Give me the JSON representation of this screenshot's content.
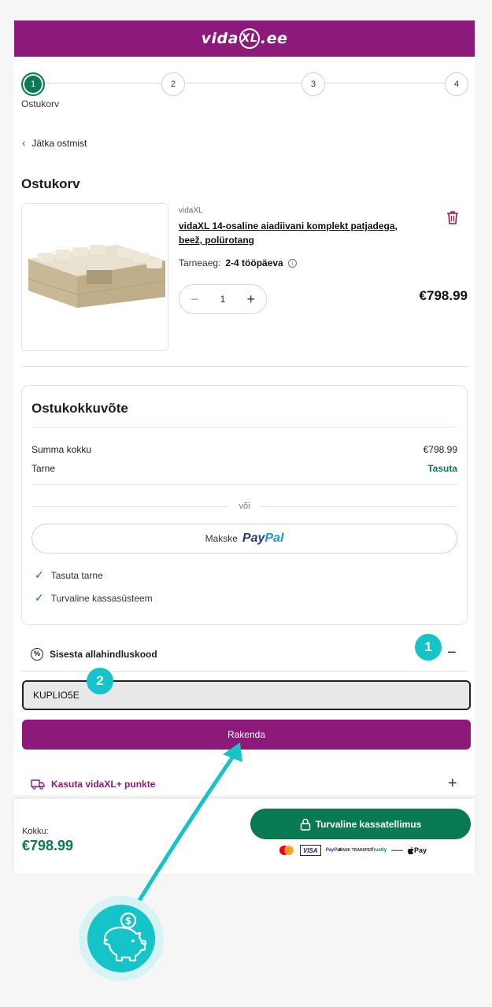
{
  "header": {
    "logo_part1": "vida",
    "logo_part2": "XL",
    "logo_part3": ".ee"
  },
  "stepper": {
    "steps": [
      "1",
      "2",
      "3",
      "4"
    ],
    "active_label": "Ostukorv"
  },
  "back_link": "Jätka ostmist",
  "cart": {
    "title": "Ostukorv",
    "item": {
      "brand": "vidaXL",
      "name": "vidaXL 14-osaline aiadiivani komplekt patjadega, beež, polürotang",
      "delivery_label": "Tarneaeg:",
      "delivery_value": "2-4 tööpäeva",
      "quantity": "1",
      "price": "€798.99"
    }
  },
  "summary": {
    "title": "Ostukokkuvõte",
    "subtotal_label": "Summa kokku",
    "subtotal_value": "€798.99",
    "shipping_label": "Tarne",
    "shipping_value": "Tasuta",
    "or_text": "või",
    "paypal_prefix": "Makske",
    "paypal_logo_a": "Pay",
    "paypal_logo_b": "Pal",
    "benefits": [
      "Tasuta tarne",
      "Turvaline kassasüsteem"
    ]
  },
  "discount": {
    "label": "Sisesta allahindluskood",
    "code_value": "KUPLIO5E",
    "apply_label": "Rakenda"
  },
  "points": {
    "label": "Kasuta vidaXL+ punkte"
  },
  "footer": {
    "total_label": "Kokku:",
    "total_value": "€798.99",
    "checkout_label": "Turvaline kassatellimus",
    "payments": {
      "visa": "VISA",
      "paypal": "PayPal",
      "bank": "BANK TRANSFER",
      "trustly": "Trustly",
      "apple": "Pay"
    }
  },
  "annotations": {
    "badge1": "1",
    "badge2": "2"
  },
  "colors": {
    "brand": "#8b1a7a",
    "accent_green": "#0a7a52",
    "annotation": "#15c4c8"
  }
}
